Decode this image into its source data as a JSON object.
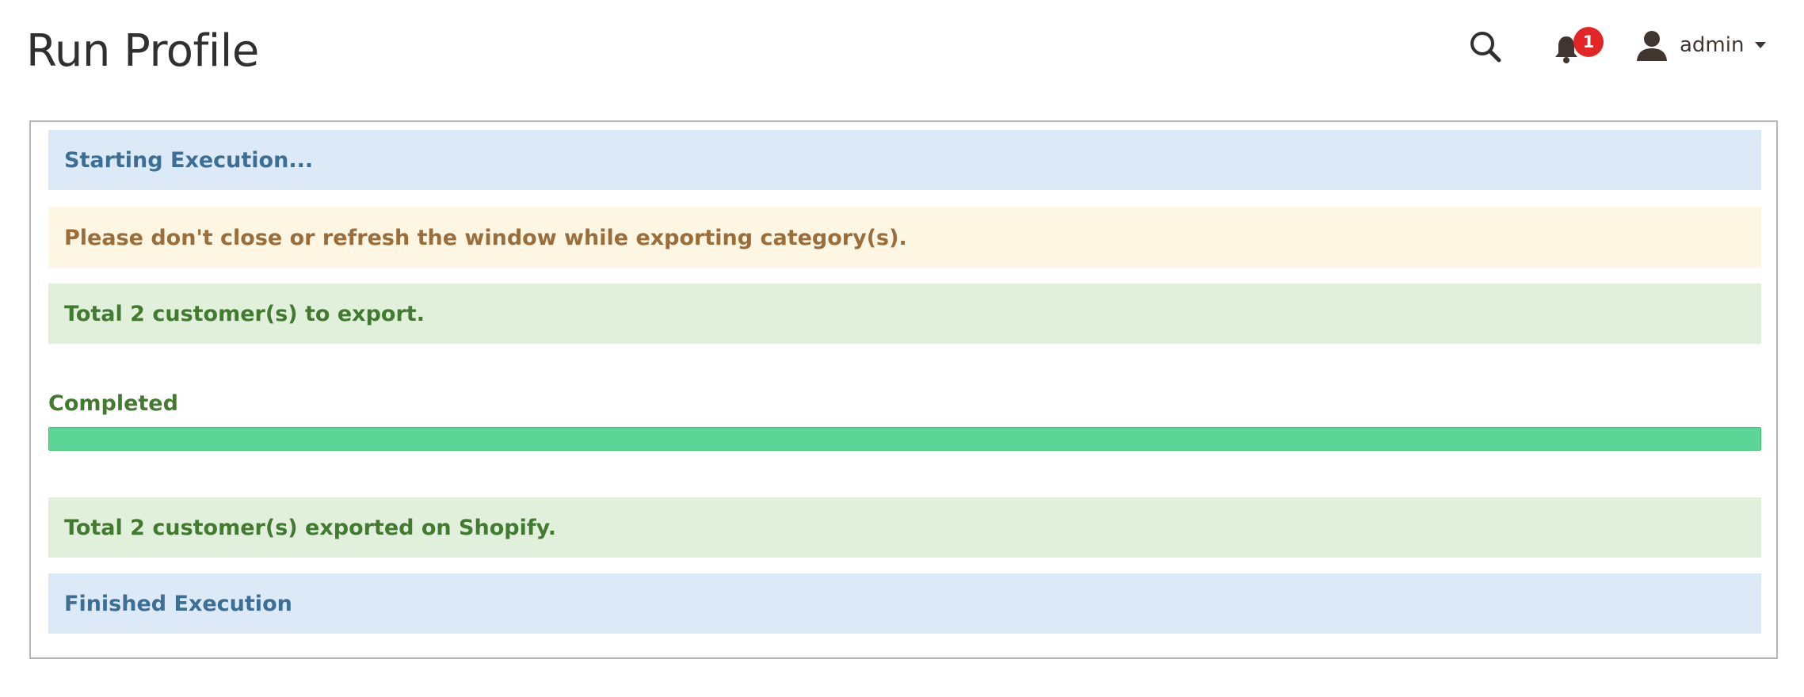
{
  "header": {
    "title": "Run Profile",
    "search_icon": "search-icon",
    "notifications": {
      "icon": "bell-icon",
      "count": "1"
    },
    "account": {
      "icon": "user-icon",
      "username": "admin"
    }
  },
  "messages": {
    "starting": "Starting Execution...",
    "warning": "Please don't close or refresh the window while exporting category(s).",
    "total": "Total 2 customer(s) to export.",
    "exported": "Total 2 customer(s) exported on Shopify.",
    "finished": "Finished Execution"
  },
  "progress": {
    "label": "Completed",
    "percent": 100
  },
  "colors": {
    "info_bg": "#dbeaf6",
    "warning_bg": "#fdf6e3",
    "success_bg": "#e0f0da",
    "progress_fill": "#5cd696",
    "badge": "#e22626"
  }
}
